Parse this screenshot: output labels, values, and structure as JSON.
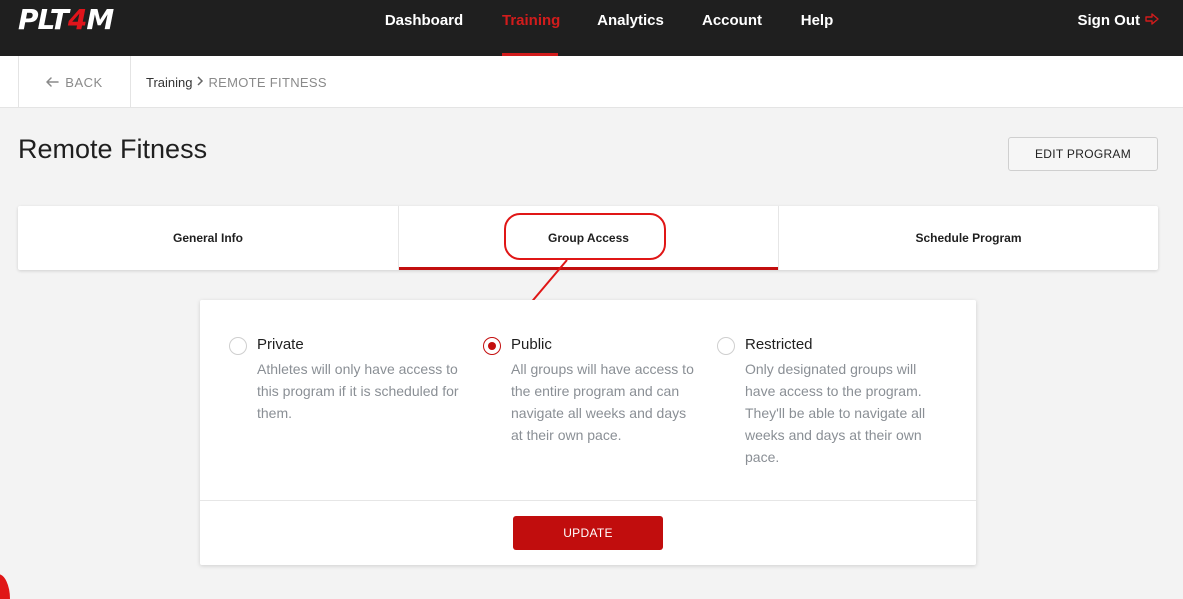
{
  "brand": {
    "logo_prefix": "PLT",
    "logo_highlight": "4",
    "logo_suffix": "M"
  },
  "nav": {
    "items": [
      {
        "label": "Dashboard",
        "active": false
      },
      {
        "label": "Training",
        "active": true
      },
      {
        "label": "Analytics",
        "active": false
      },
      {
        "label": "Account",
        "active": false
      },
      {
        "label": "Help",
        "active": false
      }
    ],
    "sign_out": "Sign Out",
    "accent_color": "#d21c1c"
  },
  "breadcrumb": {
    "back_label": "BACK",
    "items": [
      "Training",
      "REMOTE FITNESS"
    ]
  },
  "page": {
    "title": "Remote Fitness",
    "edit_button": "EDIT PROGRAM"
  },
  "tabs": [
    {
      "label": "General Info",
      "active": false
    },
    {
      "label": "Group Access",
      "active": true
    },
    {
      "label": "Schedule Program",
      "active": false
    }
  ],
  "access": {
    "selected": "Public",
    "options": [
      {
        "title": "Private",
        "description": "Athletes will only have access to this program if it is scheduled for them.",
        "checked": false
      },
      {
        "title": "Public",
        "description": "All groups will have access to the entire program and can navigate all weeks and days at their own pace.",
        "checked": true
      },
      {
        "title": "Restricted",
        "description": "Only designated groups will have access to the program. They'll be able to navigate all weeks and days at their own pace.",
        "checked": false
      }
    ],
    "update_button": "UPDATE"
  }
}
